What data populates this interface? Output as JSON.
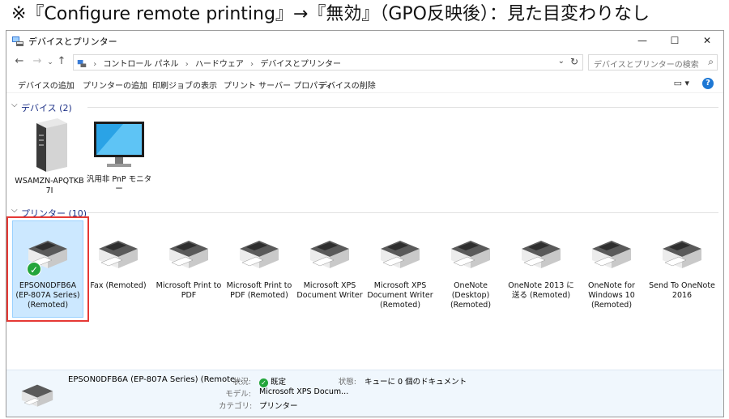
{
  "caption": "※『Configure remote printing』→『無効』（GPO反映後）：見た目変わりなし",
  "window": {
    "title": "デバイスとプリンター",
    "controls": {
      "minimize": "—",
      "maximize": "☐",
      "close": "✕"
    }
  },
  "nav": {
    "back": "←",
    "forward": "→",
    "up": "↑",
    "breadcrumbs": [
      "コントロール パネル",
      "ハードウェア",
      "デバイスとプリンター"
    ],
    "search_placeholder": "デバイスとプリンターの検索"
  },
  "toolbar": {
    "commands": [
      "デバイスの追加",
      "プリンターの追加",
      "印刷ジョブの表示",
      "プリント サーバー プロパティ",
      "デバイスの削除"
    ]
  },
  "groups": {
    "devices": {
      "label": "デバイス (2)"
    },
    "printers": {
      "label": "プリンター (10)"
    }
  },
  "devices": [
    {
      "label": "WSAMZN-APQTKB7I",
      "icon": "computer-tower-icon"
    },
    {
      "label": "汎用非 PnP モニター",
      "icon": "monitor-icon"
    }
  ],
  "printers": [
    {
      "label": "EPSON0DFB6A (EP-807A Series) (Remoted)",
      "default": true
    },
    {
      "label": "Fax (Remoted)"
    },
    {
      "label": "Microsoft Print to PDF"
    },
    {
      "label": "Microsoft Print to PDF (Remoted)"
    },
    {
      "label": "Microsoft XPS Document Writer"
    },
    {
      "label": "Microsoft XPS Document Writer (Remoted)"
    },
    {
      "label": "OneNote (Desktop) (Remoted)"
    },
    {
      "label": "OneNote 2013 に送る (Remoted)"
    },
    {
      "label": "OneNote for Windows 10 (Remoted)"
    },
    {
      "label": "Send To OneNote 2016"
    }
  ],
  "details": {
    "name": "EPSON0DFB6A (EP-807A Series) (Remote...",
    "status_key": "状況:",
    "status_value": "既定",
    "model_key": "モデル:",
    "model_value": "Microsoft XPS Docum...",
    "category_key": "カテゴリ:",
    "category_value": "プリンター",
    "state_key": "状態:",
    "state_value": "キューに 0 個のドキュメント"
  },
  "colors": {
    "selection": "#cce8ff",
    "group_label": "#1e3287",
    "highlight_box": "#e53935",
    "ok": "#23a53b"
  }
}
